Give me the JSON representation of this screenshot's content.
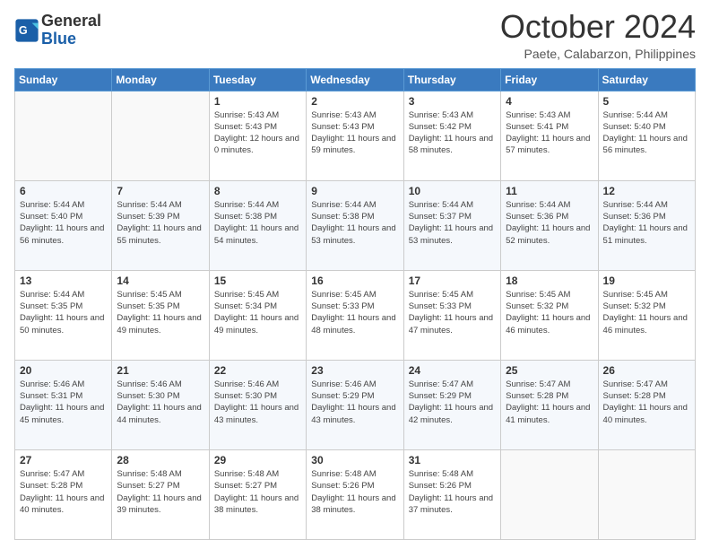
{
  "header": {
    "logo_general": "General",
    "logo_blue": "Blue",
    "month_title": "October 2024",
    "location": "Paete, Calabarzon, Philippines"
  },
  "weekdays": [
    "Sunday",
    "Monday",
    "Tuesday",
    "Wednesday",
    "Thursday",
    "Friday",
    "Saturday"
  ],
  "weeks": [
    [
      {
        "day": "",
        "info": ""
      },
      {
        "day": "",
        "info": ""
      },
      {
        "day": "1",
        "info": "Sunrise: 5:43 AM\nSunset: 5:43 PM\nDaylight: 12 hours and 0 minutes."
      },
      {
        "day": "2",
        "info": "Sunrise: 5:43 AM\nSunset: 5:43 PM\nDaylight: 11 hours and 59 minutes."
      },
      {
        "day": "3",
        "info": "Sunrise: 5:43 AM\nSunset: 5:42 PM\nDaylight: 11 hours and 58 minutes."
      },
      {
        "day": "4",
        "info": "Sunrise: 5:43 AM\nSunset: 5:41 PM\nDaylight: 11 hours and 57 minutes."
      },
      {
        "day": "5",
        "info": "Sunrise: 5:44 AM\nSunset: 5:40 PM\nDaylight: 11 hours and 56 minutes."
      }
    ],
    [
      {
        "day": "6",
        "info": "Sunrise: 5:44 AM\nSunset: 5:40 PM\nDaylight: 11 hours and 56 minutes."
      },
      {
        "day": "7",
        "info": "Sunrise: 5:44 AM\nSunset: 5:39 PM\nDaylight: 11 hours and 55 minutes."
      },
      {
        "day": "8",
        "info": "Sunrise: 5:44 AM\nSunset: 5:38 PM\nDaylight: 11 hours and 54 minutes."
      },
      {
        "day": "9",
        "info": "Sunrise: 5:44 AM\nSunset: 5:38 PM\nDaylight: 11 hours and 53 minutes."
      },
      {
        "day": "10",
        "info": "Sunrise: 5:44 AM\nSunset: 5:37 PM\nDaylight: 11 hours and 53 minutes."
      },
      {
        "day": "11",
        "info": "Sunrise: 5:44 AM\nSunset: 5:36 PM\nDaylight: 11 hours and 52 minutes."
      },
      {
        "day": "12",
        "info": "Sunrise: 5:44 AM\nSunset: 5:36 PM\nDaylight: 11 hours and 51 minutes."
      }
    ],
    [
      {
        "day": "13",
        "info": "Sunrise: 5:44 AM\nSunset: 5:35 PM\nDaylight: 11 hours and 50 minutes."
      },
      {
        "day": "14",
        "info": "Sunrise: 5:45 AM\nSunset: 5:35 PM\nDaylight: 11 hours and 49 minutes."
      },
      {
        "day": "15",
        "info": "Sunrise: 5:45 AM\nSunset: 5:34 PM\nDaylight: 11 hours and 49 minutes."
      },
      {
        "day": "16",
        "info": "Sunrise: 5:45 AM\nSunset: 5:33 PM\nDaylight: 11 hours and 48 minutes."
      },
      {
        "day": "17",
        "info": "Sunrise: 5:45 AM\nSunset: 5:33 PM\nDaylight: 11 hours and 47 minutes."
      },
      {
        "day": "18",
        "info": "Sunrise: 5:45 AM\nSunset: 5:32 PM\nDaylight: 11 hours and 46 minutes."
      },
      {
        "day": "19",
        "info": "Sunrise: 5:45 AM\nSunset: 5:32 PM\nDaylight: 11 hours and 46 minutes."
      }
    ],
    [
      {
        "day": "20",
        "info": "Sunrise: 5:46 AM\nSunset: 5:31 PM\nDaylight: 11 hours and 45 minutes."
      },
      {
        "day": "21",
        "info": "Sunrise: 5:46 AM\nSunset: 5:30 PM\nDaylight: 11 hours and 44 minutes."
      },
      {
        "day": "22",
        "info": "Sunrise: 5:46 AM\nSunset: 5:30 PM\nDaylight: 11 hours and 43 minutes."
      },
      {
        "day": "23",
        "info": "Sunrise: 5:46 AM\nSunset: 5:29 PM\nDaylight: 11 hours and 43 minutes."
      },
      {
        "day": "24",
        "info": "Sunrise: 5:47 AM\nSunset: 5:29 PM\nDaylight: 11 hours and 42 minutes."
      },
      {
        "day": "25",
        "info": "Sunrise: 5:47 AM\nSunset: 5:28 PM\nDaylight: 11 hours and 41 minutes."
      },
      {
        "day": "26",
        "info": "Sunrise: 5:47 AM\nSunset: 5:28 PM\nDaylight: 11 hours and 40 minutes."
      }
    ],
    [
      {
        "day": "27",
        "info": "Sunrise: 5:47 AM\nSunset: 5:28 PM\nDaylight: 11 hours and 40 minutes."
      },
      {
        "day": "28",
        "info": "Sunrise: 5:48 AM\nSunset: 5:27 PM\nDaylight: 11 hours and 39 minutes."
      },
      {
        "day": "29",
        "info": "Sunrise: 5:48 AM\nSunset: 5:27 PM\nDaylight: 11 hours and 38 minutes."
      },
      {
        "day": "30",
        "info": "Sunrise: 5:48 AM\nSunset: 5:26 PM\nDaylight: 11 hours and 38 minutes."
      },
      {
        "day": "31",
        "info": "Sunrise: 5:48 AM\nSunset: 5:26 PM\nDaylight: 11 hours and 37 minutes."
      },
      {
        "day": "",
        "info": ""
      },
      {
        "day": "",
        "info": ""
      }
    ]
  ]
}
